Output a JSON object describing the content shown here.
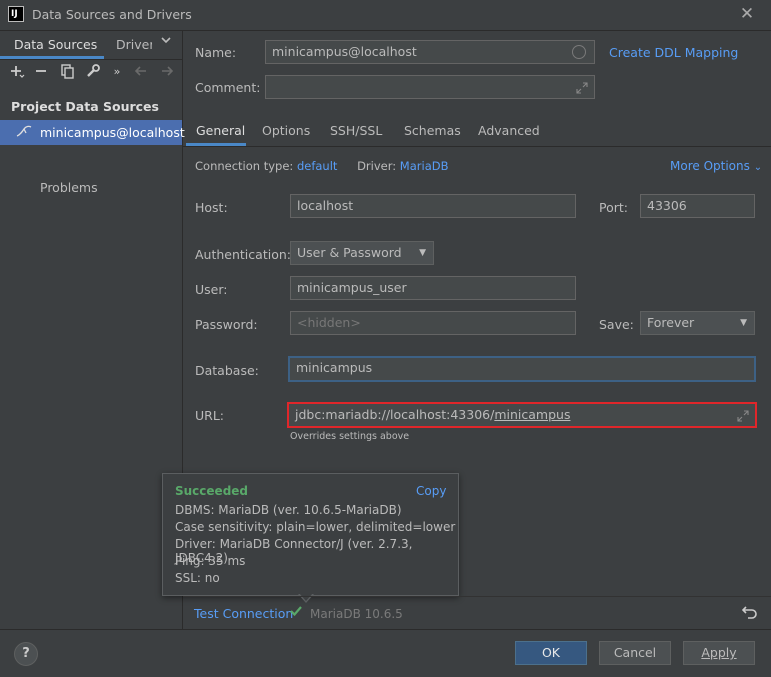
{
  "window": {
    "title": "Data Sources and Drivers",
    "logo": "IJ"
  },
  "left": {
    "tabs": [
      "Data Sources",
      "Drivers"
    ],
    "toolbar_icons": [
      "add-icon",
      "remove-icon",
      "copy-icon",
      "wrench-icon",
      "more-icon",
      "back-icon",
      "forward-icon"
    ],
    "section_header": "Project Data Sources",
    "items": [
      {
        "label": "minicampus@localhost",
        "icon": "mariadb-icon"
      }
    ],
    "problems": "Problems"
  },
  "header": {
    "name_label": "Name:",
    "name_value": "minicampus@localhost",
    "create_ddl": "Create DDL Mapping",
    "comment_label": "Comment:",
    "comment_value": ""
  },
  "tabs": [
    "General",
    "Options",
    "SSH/SSL",
    "Schemas",
    "Advanced"
  ],
  "general": {
    "conn_type_label": "Connection type:",
    "conn_type_value": "default",
    "driver_label": "Driver:",
    "driver_value": "MariaDB",
    "more_options": "More Options",
    "host_label": "Host:",
    "host_value": "localhost",
    "port_label": "Port:",
    "port_value": "43306",
    "auth_label": "Authentication:",
    "auth_value": "User & Password",
    "user_label": "User:",
    "user_value": "minicampus_user",
    "password_label": "Password:",
    "password_placeholder": "<hidden>",
    "save_label": "Save:",
    "save_value": "Forever",
    "database_label": "Database:",
    "database_value": "minicampus",
    "url_label": "URL:",
    "url_prefix": "jdbc:mariadb://localhost:43306/",
    "url_db": "minicampus",
    "url_note": "Overrides settings above"
  },
  "tooltip": {
    "status": "Succeeded",
    "copy": "Copy",
    "lines": [
      "DBMS: MariaDB (ver. 10.6.5-MariaDB)",
      "Case sensitivity: plain=lower, delimited=lower",
      "Driver: MariaDB Connector/J (ver. 2.7.3, JDBC4.2)",
      "Ping: 35 ms",
      "SSL: no"
    ]
  },
  "test": {
    "label": "Test Connection",
    "result": "MariaDB 10.6.5"
  },
  "footer": {
    "help": "?",
    "ok": "OK",
    "cancel": "Cancel",
    "apply": "Apply"
  },
  "colors": {
    "accent": "#4a88c7",
    "link": "#589df6",
    "success": "#59a869",
    "url_border": "#e0262a",
    "selection": "#4b6eaf"
  }
}
